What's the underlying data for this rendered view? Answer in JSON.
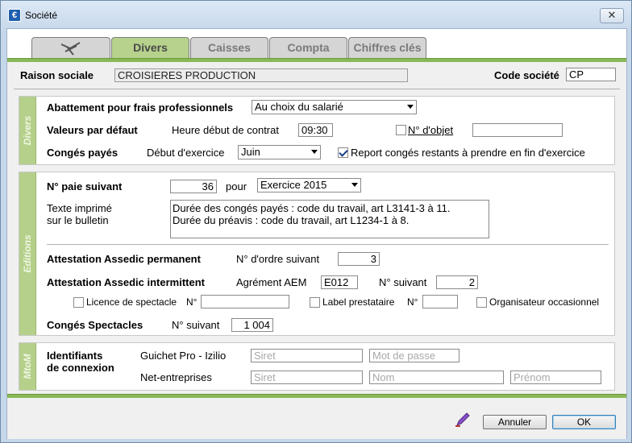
{
  "window": {
    "title": "Société",
    "close": "✕"
  },
  "tabs": [
    {
      "label": "",
      "icon": "aircraft-icon"
    },
    {
      "label": "Divers",
      "active": true
    },
    {
      "label": "Caisses"
    },
    {
      "label": "Compta"
    },
    {
      "label": "Chiffres clés"
    }
  ],
  "header": {
    "raison_label": "Raison sociale",
    "raison_value": "CROISIERES PRODUCTION",
    "code_label": "Code société",
    "code_value": "CP"
  },
  "divers": {
    "section_label": "Divers",
    "abattement_label": "Abattement pour frais professionnels",
    "abattement_value": "Au choix du salarié",
    "valeurs_label": "Valeurs par défaut",
    "heure_label": "Heure début de contrat",
    "heure_value": "09:30",
    "objet_label": "N° d'objet",
    "objet_checked": false,
    "objet_value": "",
    "conges_label": "Congés payés",
    "debut_label": "Début d'exercice",
    "debut_value": "Juin",
    "report_label": "Report congés restants à prendre en fin d'exercice",
    "report_checked": true
  },
  "editions": {
    "section_label": "Editions",
    "paie_label": "N° paie suivant",
    "paie_value": "36",
    "pour_label": "pour",
    "exercice_value": "Exercice 2015",
    "texte_label_1": "Texte imprimé",
    "texte_label_2": "sur le bulletin",
    "texte_line_1": "Durée des congés payés : code du travail, art L3141-3 à 11.",
    "texte_line_2": "Durée du préavis : code du travail, art L1234-1 à 8.",
    "assedic_perm_label": "Attestation Assedic permanent",
    "ordre_label": "N° d'ordre suivant",
    "ordre_value": "3",
    "assedic_inter_label": "Attestation Assedic intermittent",
    "agrement_label": "Agrément AEM",
    "agrement_value": "E012",
    "suivant_label": "N° suivant",
    "suivant_value": "2",
    "licence_label": "Licence de spectacle",
    "licence_no_label": "N°",
    "licence_value": "",
    "label_presta_label": "Label prestataire",
    "label_no_label": "N°",
    "label_value": "",
    "organisateur_label": "Organisateur occasionnel",
    "conges_spect_label": "Congés Spectacles",
    "spect_suivant_label": "N° suivant",
    "spect_suivant_value": "1 004"
  },
  "mtom": {
    "section_label": "MtoM",
    "ident_label_1": "Identifiants",
    "ident_label_2": "de connexion",
    "guichet_label": "Guichet Pro - Izilio",
    "guichet_siret_ph": "Siret",
    "guichet_pass_ph": "Mot de passe",
    "net_label": "Net-entreprises",
    "net_siret_ph": "Siret",
    "net_nom_ph": "Nom",
    "net_prenom_ph": "Prénom"
  },
  "footer": {
    "cancel_label": "Annuler",
    "ok_label": "OK",
    "edit_icon": "pen-icon"
  }
}
